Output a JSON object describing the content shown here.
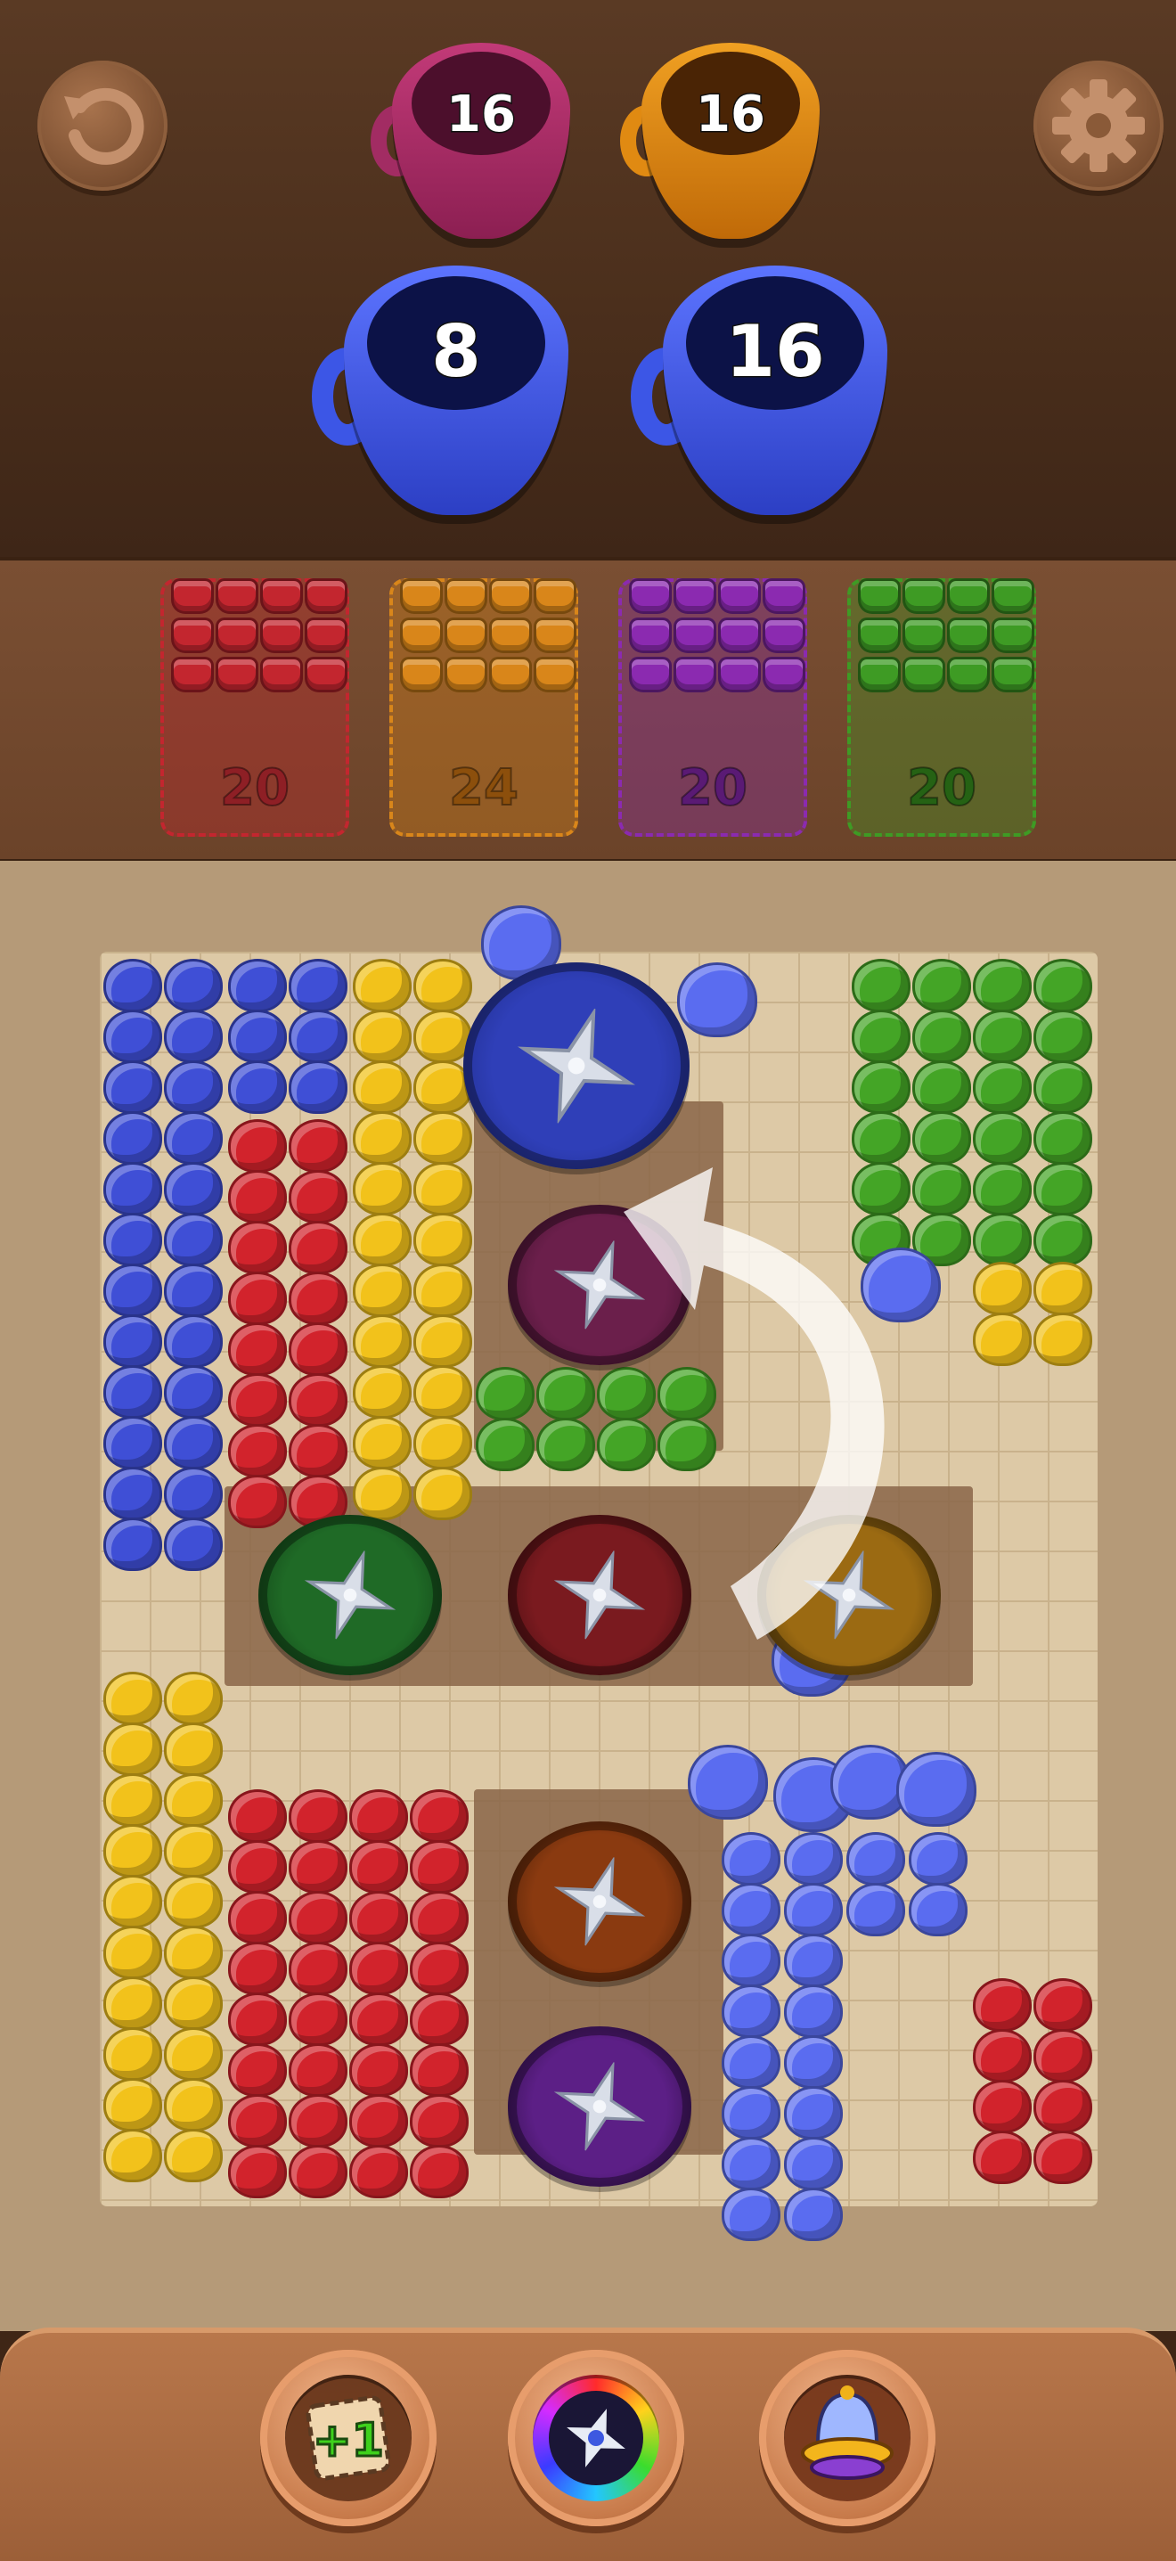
{
  "cups_top": [
    {
      "value": "16",
      "color": "#a22c63"
    },
    {
      "value": "16",
      "color": "#e08a12"
    }
  ],
  "cups_bottom": [
    {
      "value": "8",
      "color": "#3c56e6"
    },
    {
      "value": "16",
      "color": "#3c56e6"
    }
  ],
  "boxes": [
    {
      "count": "20",
      "color": "#c3262f"
    },
    {
      "count": "24",
      "color": "#d9861a"
    },
    {
      "count": "20",
      "color": "#8b2ab0"
    },
    {
      "count": "20",
      "color": "#3e9b24"
    }
  ],
  "holes": [
    {
      "color": "#2f3fb8",
      "ring": "#1b2880"
    },
    {
      "color": "#6b1f4b",
      "ring": "#3a0f28"
    },
    {
      "color": "#1f6a26",
      "ring": "#0f3a14"
    },
    {
      "color": "#7a1a1f",
      "ring": "#3b0b0e"
    },
    {
      "color": "#9b6a12",
      "ring": "#4a3307"
    },
    {
      "color": "#8a3a10",
      "ring": "#3f1a06"
    },
    {
      "color": "#5c1f86",
      "ring": "#2c0d42"
    }
  ],
  "powerups": [
    {
      "name": "add-slot",
      "label": "+1"
    },
    {
      "name": "rainbow-spinner"
    },
    {
      "name": "bell"
    }
  ]
}
